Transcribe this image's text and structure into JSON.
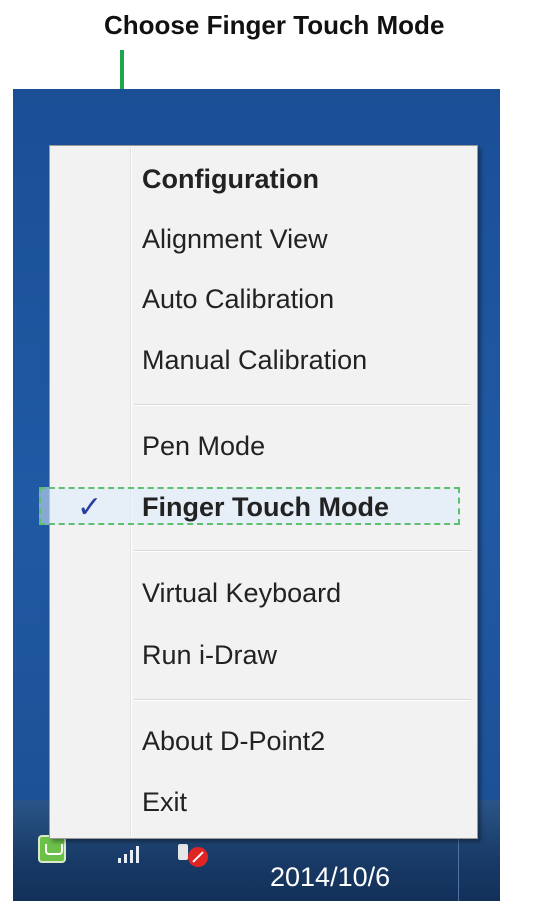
{
  "annotation": {
    "title": "Choose Finger Touch Mode",
    "color": "#1fa64a"
  },
  "menu": {
    "items": [
      {
        "label": "Configuration",
        "bold": true
      },
      {
        "label": "Alignment View"
      },
      {
        "label": "Auto Calibration"
      },
      {
        "label": "Manual Calibration"
      },
      {
        "label": "Pen Mode"
      },
      {
        "label": "Finger Touch Mode",
        "bold": true,
        "checked": true
      },
      {
        "label": "Virtual Keyboard"
      },
      {
        "label": "Run i-Draw"
      },
      {
        "label": "About D-Point2"
      },
      {
        "label": "Exit"
      }
    ],
    "check_glyph": "✓"
  },
  "taskbar": {
    "date": "2014/10/6",
    "icons": [
      "dpoint-tray-icon",
      "signal-icon",
      "volume-muted-icon"
    ]
  }
}
